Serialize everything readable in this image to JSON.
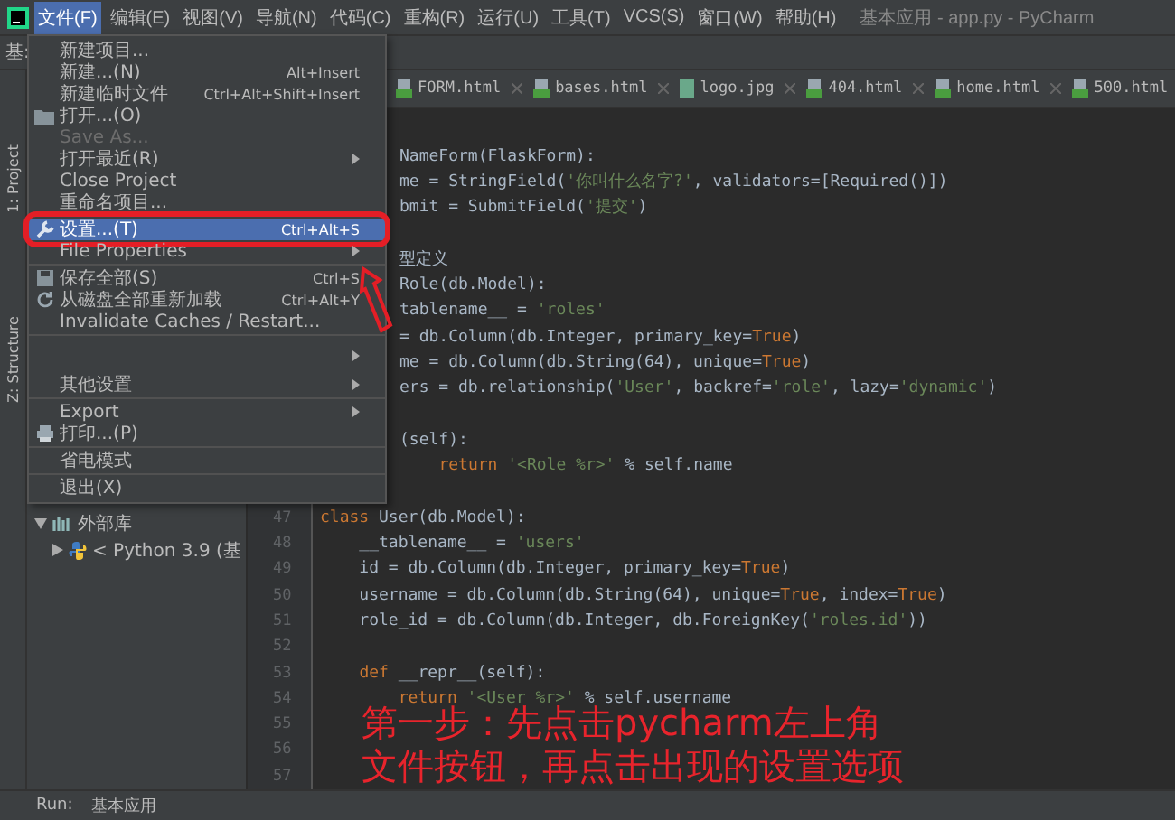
{
  "menu_bar": {
    "items": [
      {
        "label": "文件(F)",
        "selected": true
      },
      {
        "label": "编辑(E)",
        "selected": false
      },
      {
        "label": "视图(V)",
        "selected": false
      },
      {
        "label": "导航(N)",
        "selected": false
      },
      {
        "label": "代码(C)",
        "selected": false
      },
      {
        "label": "重构(R)",
        "selected": false
      },
      {
        "label": "运行(U)",
        "selected": false
      },
      {
        "label": "工具(T)",
        "selected": false
      },
      {
        "label": "VCS(S)",
        "selected": false
      },
      {
        "label": "窗口(W)",
        "selected": false
      },
      {
        "label": "帮助(H)",
        "selected": false
      }
    ],
    "title": "基本应用 - app.py - PyCharm"
  },
  "nav_bar": {
    "crumb": "基:"
  },
  "tool_strip": [
    "1: Project",
    "Z: Structure"
  ],
  "file_menu": [
    {
      "kind": "plain",
      "label": "新建项目...",
      "submenu": false,
      "selected": false,
      "disabled": false
    },
    {
      "kind": "plain",
      "label": "新建...(N)",
      "shortcut": "Alt+Insert",
      "submenu": false,
      "selected": false,
      "disabled": false
    },
    {
      "kind": "plain",
      "label": "新建临时文件",
      "shortcut": "Ctrl+Alt+Shift+Insert",
      "submenu": false,
      "selected": false,
      "disabled": false
    },
    {
      "kind": "folder",
      "label": "打开...(O)",
      "submenu": false,
      "selected": false,
      "disabled": false
    },
    {
      "kind": "plain",
      "label": "Save As...",
      "submenu": false,
      "selected": false,
      "disabled": true
    },
    {
      "kind": "plain",
      "label": "打开最近(R)",
      "submenu": true,
      "selected": false,
      "disabled": false
    },
    {
      "kind": "plain",
      "label": "Close Project",
      "submenu": false,
      "selected": false,
      "disabled": false
    },
    {
      "kind": "plain",
      "label": "重命名项目...",
      "submenu": false,
      "selected": false,
      "disabled": false
    },
    {
      "kind": "separator"
    },
    {
      "kind": "wrench",
      "label": "设置...(T)",
      "shortcut": "Ctrl+Alt+S",
      "submenu": false,
      "selected": true,
      "disabled": false
    },
    {
      "kind": "plain",
      "label": "File Properties",
      "submenu": true,
      "selected": false,
      "disabled": false
    },
    {
      "kind": "separator"
    },
    {
      "kind": "disk",
      "label": "保存全部(S)",
      "shortcut": "Ctrl+S",
      "submenu": false,
      "selected": false,
      "disabled": false
    },
    {
      "kind": "refresh",
      "label": "从磁盘全部重新加载",
      "shortcut": "Ctrl+Alt+Y",
      "submenu": false,
      "selected": false,
      "disabled": false
    },
    {
      "kind": "plain",
      "label": "Invalidate Caches / Restart...",
      "submenu": false,
      "selected": false,
      "disabled": false
    },
    {
      "kind": "separator"
    },
    {
      "kind": "plain",
      "submenu": true,
      "selected": false,
      "disabled": false
    },
    {
      "kind": "plain",
      "label": "其他设置",
      "submenu": true,
      "selected": false,
      "disabled": false
    },
    {
      "kind": "separator"
    },
    {
      "kind": "plain",
      "label": "Export",
      "submenu": true,
      "selected": false,
      "disabled": false
    },
    {
      "kind": "printer",
      "label": "打印...(P)",
      "submenu": false,
      "selected": false,
      "disabled": false
    },
    {
      "kind": "separator"
    },
    {
      "kind": "plain",
      "label": "省电模式",
      "submenu": false,
      "selected": false,
      "disabled": false
    },
    {
      "kind": "separator"
    },
    {
      "kind": "plain",
      "label": "退出(X)",
      "submenu": false,
      "selected": false,
      "disabled": false
    }
  ],
  "editor_tabs": [
    {
      "label": "FORM.html",
      "kind": "html",
      "selected": false
    },
    {
      "label": "bases.html",
      "kind": "html",
      "selected": false
    },
    {
      "label": "logo.jpg",
      "kind": "image",
      "selected": false
    },
    {
      "label": "404.html",
      "kind": "html",
      "selected": false
    },
    {
      "label": "home.html",
      "kind": "html",
      "selected": false
    },
    {
      "label": "500.html",
      "kind": "html",
      "selected": false
    }
  ],
  "project_tree": [
    {
      "label": "外部库",
      "kind": "library",
      "expanded": true,
      "children": [
        {
          "label": "< Python 3.9 (基",
          "kind": "python",
          "expanded": false
        }
      ]
    }
  ],
  "code_lines": [
    {
      "text": "NameForm(FlaskForm):",
      "kind": "partial"
    },
    {
      "text": "me = StringField('你叫什么名字?', validators=[Required()])",
      "kind": "partial"
    },
    {
      "text": "bmit = SubmitField('提交')",
      "kind": "partial"
    },
    {
      "kind": "partial"
    },
    {
      "text": "型定义",
      "kind": "partial"
    },
    {
      "text": "Role(db.Model):",
      "kind": "partial"
    },
    {
      "text": "tablename__ = 'roles'",
      "kind": "partial"
    },
    {
      "text": "= db.Column(db.Integer, primary_key=True)",
      "kind": "partial"
    },
    {
      "text": "me = db.Column(db.String(64), unique=True)",
      "kind": "partial"
    },
    {
      "text": "ers = db.relationship('User', backref='role', lazy='dynamic')",
      "kind": "partial"
    },
    {
      "kind": "partial"
    },
    {
      "text": "(self):",
      "kind": "partial"
    },
    {
      "text": "    return '<Role %r>' % self.name",
      "kind": "partial"
    },
    {
      "kind": "partial"
    },
    {
      "number": "47",
      "text": "class User(db.Model):",
      "kind": "full"
    },
    {
      "number": "48",
      "text": "    __tablename__ = 'users'",
      "kind": "full"
    },
    {
      "number": "49",
      "text": "    id = db.Column(db.Integer, primary_key=True)",
      "kind": "full"
    },
    {
      "number": "50",
      "text": "    username = db.Column(db.String(64), unique=True, index=True)",
      "kind": "full"
    },
    {
      "number": "51",
      "text": "    role_id = db.Column(db.Integer, db.ForeignKey('roles.id'))",
      "kind": "full"
    },
    {
      "number": "52",
      "kind": "full"
    },
    {
      "number": "53",
      "text": "    def __repr__(self):",
      "kind": "full"
    },
    {
      "number": "54",
      "text": "        return '<User %r>' % self.username",
      "kind": "full"
    },
    {
      "number": "55",
      "kind": "full"
    },
    {
      "number": "56",
      "kind": "full"
    },
    {
      "number": "57",
      "kind": "full"
    }
  ],
  "annotation": {
    "lines": [
      "第一步：先点击pycharm左上角",
      "文件按钮，再点击出现的设置选项"
    ]
  },
  "status_bar": {
    "label": "Run:",
    "run_config": "基本应用"
  }
}
